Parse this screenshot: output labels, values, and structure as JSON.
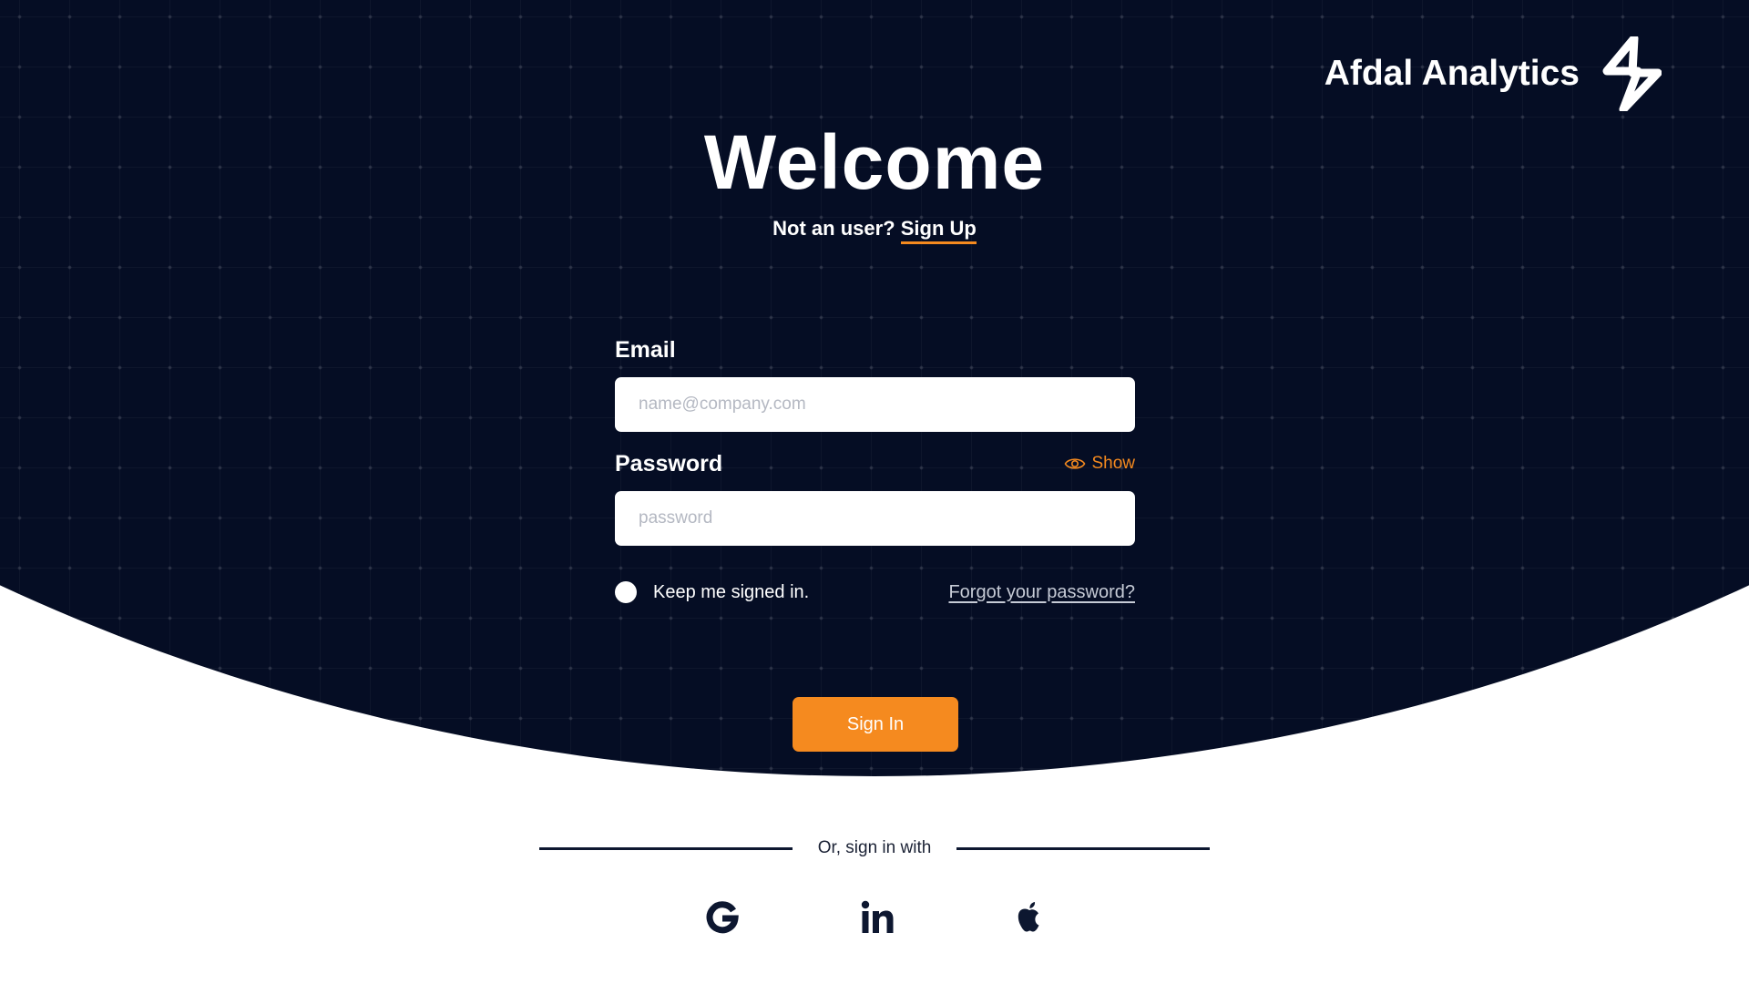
{
  "brand": {
    "name": "Afdal Analytics",
    "logo_icon": "lightning-bolt-icon"
  },
  "hero": {
    "title": "Welcome",
    "signup_prompt": "Not an user?",
    "signup_link": "Sign Up"
  },
  "form": {
    "email_label": "Email",
    "email_placeholder": "name@company.com",
    "email_value": "",
    "password_label": "Password",
    "password_placeholder": "password",
    "password_value": "",
    "show_label": "Show",
    "show_icon": "eye-icon",
    "keep_signed_label": "Keep me signed in.",
    "keep_signed_checked": false,
    "forgot_label": "Forgot your password?",
    "submit_label": "Sign In"
  },
  "social": {
    "divider_label": "Or, sign in with",
    "providers": [
      {
        "name": "Google",
        "icon": "google-icon"
      },
      {
        "name": "LinkedIn",
        "icon": "linkedin-icon"
      },
      {
        "name": "Apple",
        "icon": "apple-icon"
      }
    ]
  },
  "colors": {
    "background_dark": "#050d24",
    "accent": "#f58a1f",
    "surface": "#ffffff"
  }
}
